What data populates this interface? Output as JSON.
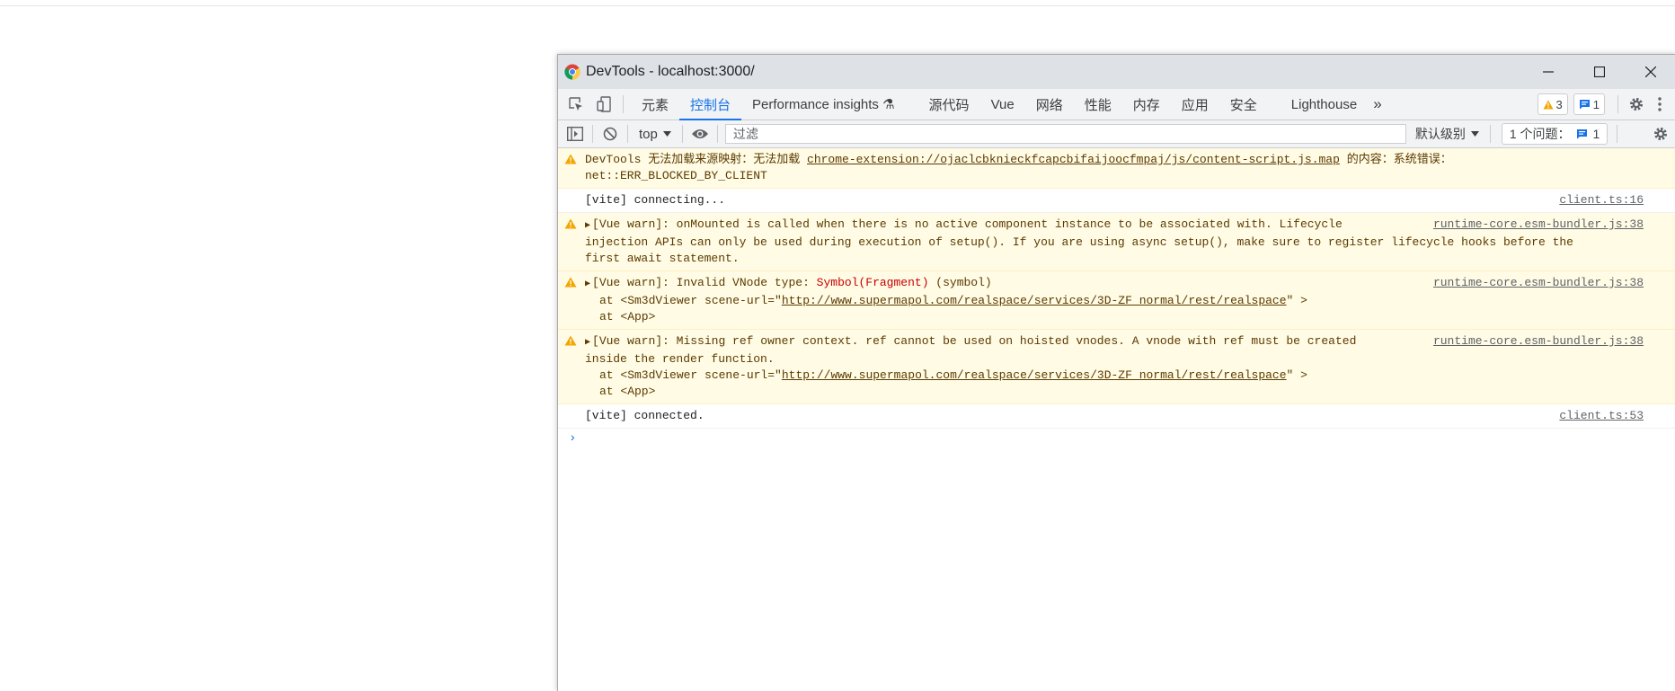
{
  "window": {
    "title": "DevTools - localhost:3000/"
  },
  "tabs": [
    {
      "label": "元素"
    },
    {
      "label": "控制台",
      "active": true
    },
    {
      "label": "Performance insights ⚗"
    },
    {
      "label": "源代码"
    },
    {
      "label": "Vue"
    },
    {
      "label": "网络"
    },
    {
      "label": "性能"
    },
    {
      "label": "内存"
    },
    {
      "label": "应用"
    },
    {
      "label": "安全"
    },
    {
      "label": "Lighthouse"
    },
    {
      "label": "»"
    }
  ],
  "tab_badges": {
    "warnings": "3",
    "messages": "1"
  },
  "console_toolbar": {
    "context": "top",
    "filter_placeholder": "过滤",
    "levels": "默认级别",
    "issues_label": "1 个问题：",
    "issues_count": "1"
  },
  "messages": [
    {
      "type": "warn",
      "pre": "DevTools 无法加载来源映射：无法加载 ",
      "link": "chrome-extension://ojaclcbknieckfcapcbifaijoocfmpaj/js/content-script.js.map",
      "post": " 的内容：系统错误：",
      "line2": "net::ERR_BLOCKED_BY_CLIENT"
    },
    {
      "type": "plain",
      "text": "[vite] connecting...",
      "source": "client.ts:16"
    },
    {
      "type": "warn",
      "line1": "[Vue warn]: onMounted is called when there is no active component instance to be associated with. Lifecycle",
      "line2": "injection APIs can only be used during execution of setup(). If you are using async setup(), make sure to register lifecycle hooks before the",
      "line3": "first await statement.",
      "source": "runtime-core.esm-bundler.js:38"
    },
    {
      "type": "warn",
      "pre": "[Vue warn]: Invalid VNode type: ",
      "red": "Symbol(Fragment)",
      "post": " (symbol)",
      "at1_pre": "at <Sm3dViewer scene-url=\"",
      "at1_link": "http://www.supermapol.com/realspace/services/3D-ZF_normal/rest/realspace",
      "at1_post": "\" >",
      "at2": "at <App>",
      "source": "runtime-core.esm-bundler.js:38"
    },
    {
      "type": "warn",
      "line1": "[Vue warn]: Missing ref owner context. ref cannot be used on hoisted vnodes. A vnode with ref must be created",
      "line2": "inside the render function.",
      "at1_pre": "at <Sm3dViewer scene-url=\"",
      "at1_link": "http://www.supermapol.com/realspace/services/3D-ZF_normal/rest/realspace",
      "at1_post": "\" >",
      "at2": "at <App>",
      "source": "runtime-core.esm-bundler.js:38"
    },
    {
      "type": "plain",
      "text": "[vite] connected.",
      "source": "client.ts:53"
    }
  ],
  "prompt": "›",
  "colors": {
    "accent": "#1a73e8",
    "warn_bg": "#fffbe5",
    "warn_text": "#5c3b00",
    "warn_icon": "#f2a600"
  }
}
